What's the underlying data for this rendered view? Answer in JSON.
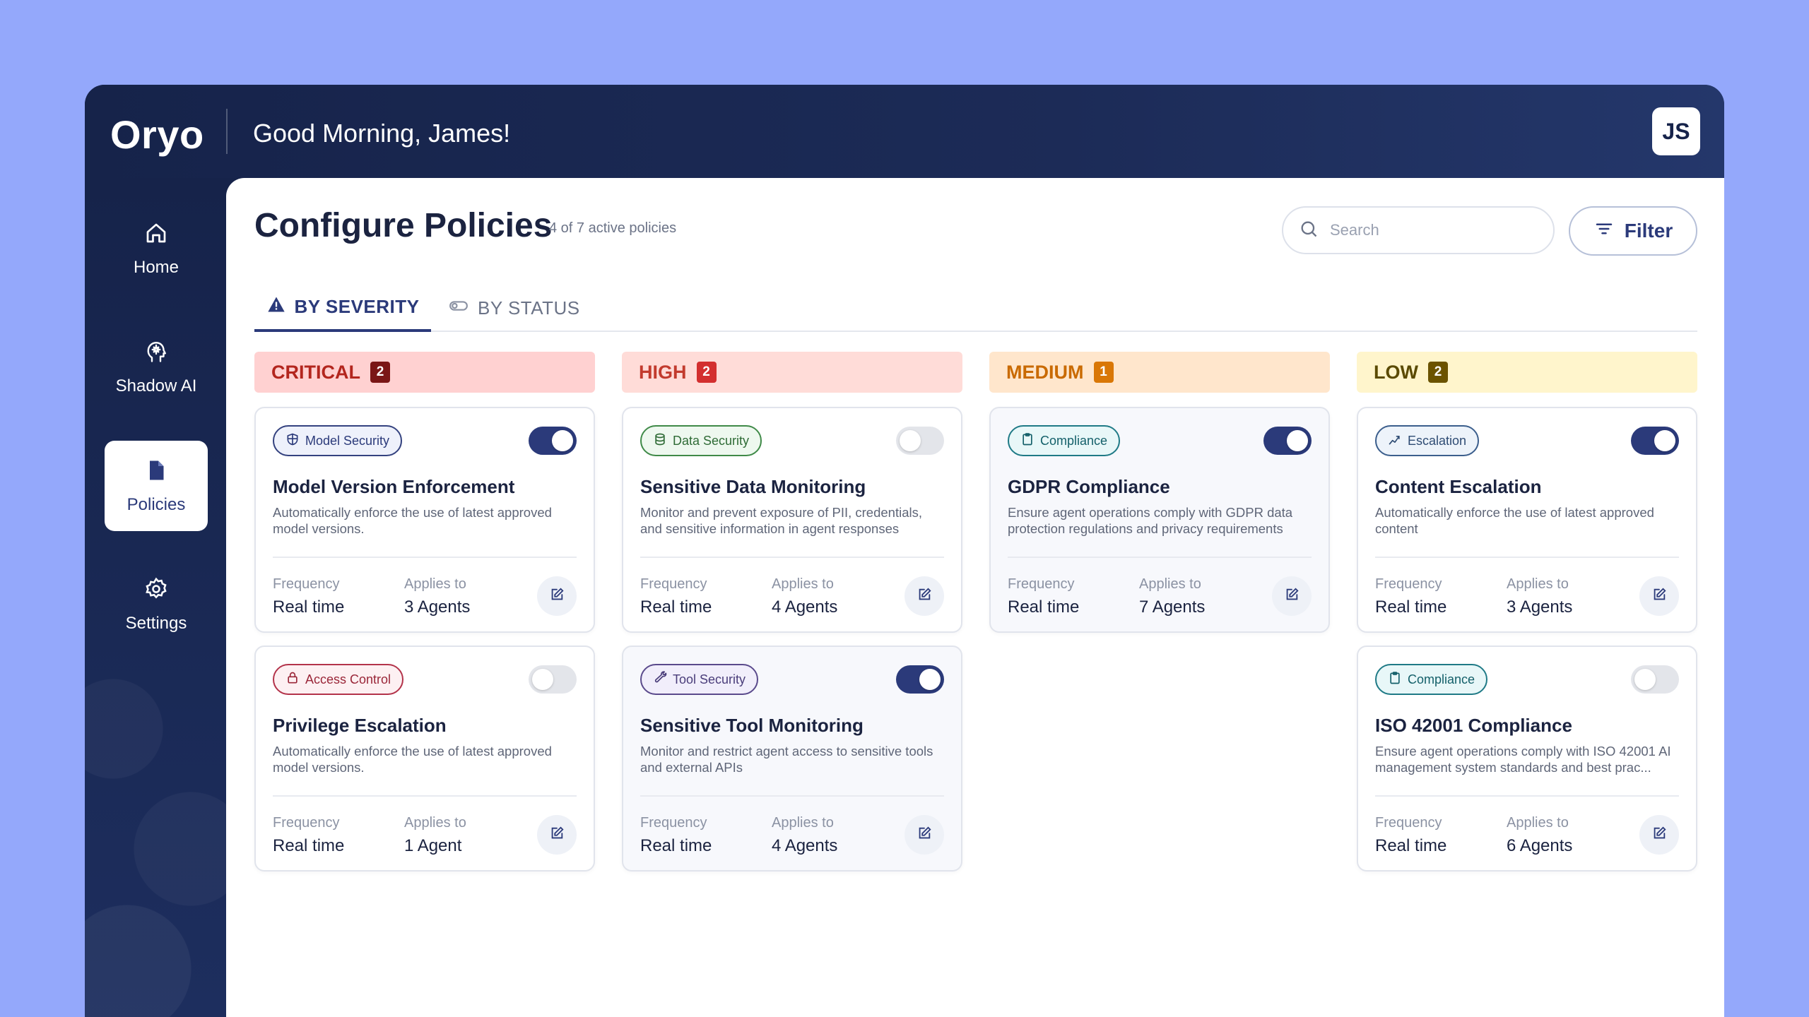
{
  "app": {
    "logo": "Oryo",
    "greeting": "Good Morning, James!",
    "avatar_initials": "JS"
  },
  "sidebar": {
    "items": [
      {
        "label": "Home",
        "icon": "home-icon",
        "active": false
      },
      {
        "label": "Shadow AI",
        "icon": "brain-icon",
        "active": false
      },
      {
        "label": "Policies",
        "icon": "document-icon",
        "active": true
      },
      {
        "label": "Settings",
        "icon": "gear-icon",
        "active": false
      }
    ]
  },
  "header": {
    "title": "Configure Policies",
    "subtitle": "4 of 7 active policies",
    "search_placeholder": "Search",
    "filter_label": "Filter"
  },
  "tabs": [
    {
      "label": "BY SEVERITY",
      "icon": "warning-icon",
      "active": true
    },
    {
      "label": "BY STATUS",
      "icon": "toggle-icon",
      "active": false
    }
  ],
  "colors": {
    "accent": "#2b3a7a",
    "critical_bg": "#ffd1d1",
    "critical_text": "#b3261e",
    "critical_badge": "#7a1616",
    "high_bg": "#ffdcd8",
    "high_text": "#c23b2e",
    "high_badge": "#d32f2f",
    "medium_bg": "#ffe6cc",
    "medium_text": "#c96a00",
    "medium_badge": "#d97706",
    "low_bg": "#fff5cc",
    "low_text": "#5a4a00",
    "low_badge": "#6b5300"
  },
  "columns": [
    {
      "label": "CRITICAL",
      "count": "2",
      "cards": [
        {
          "tag": "Model Security",
          "tag_icon": "shield-icon",
          "enabled": true,
          "title": "Model Version Enforcement",
          "description": "Automatically enforce the use of latest approved model versions.",
          "frequency_label": "Frequency",
          "frequency": "Real time",
          "applies_label": "Applies to",
          "applies": "3 Agents"
        },
        {
          "tag": "Access Control",
          "tag_icon": "lock-icon",
          "enabled": false,
          "title": "Privilege Escalation",
          "description": "Automatically enforce the use of latest approved model versions.",
          "frequency_label": "Frequency",
          "frequency": "Real time",
          "applies_label": "Applies to",
          "applies": "1 Agent"
        }
      ]
    },
    {
      "label": "HIGH",
      "count": "2",
      "cards": [
        {
          "tag": "Data Security",
          "tag_icon": "database-icon",
          "enabled": false,
          "title": "Sensitive Data Monitoring",
          "description": "Monitor and prevent exposure of PII, credentials, and sensitive information in agent responses",
          "frequency_label": "Frequency",
          "frequency": "Real time",
          "applies_label": "Applies to",
          "applies": "4 Agents"
        },
        {
          "tag": "Tool Security",
          "tag_icon": "wrench-icon",
          "enabled": true,
          "title": "Sensitive Tool Monitoring",
          "description": "Monitor and restrict agent access to sensitive tools and external APIs",
          "frequency_label": "Frequency",
          "frequency": "Real time",
          "applies_label": "Applies to",
          "applies": "4 Agents"
        }
      ]
    },
    {
      "label": "MEDIUM",
      "count": "1",
      "cards": [
        {
          "tag": "Compliance",
          "tag_icon": "clipboard-icon",
          "enabled": true,
          "title": "GDPR Compliance",
          "description": "Ensure agent operations comply with GDPR data protection regulations and privacy requirements",
          "frequency_label": "Frequency",
          "frequency": "Real time",
          "applies_label": "Applies to",
          "applies": "7 Agents"
        }
      ]
    },
    {
      "label": "LOW",
      "count": "2",
      "cards": [
        {
          "tag": "Escalation",
          "tag_icon": "trend-icon",
          "enabled": true,
          "title": "Content Escalation",
          "description": "Automatically enforce the use of latest approved content",
          "frequency_label": "Frequency",
          "frequency": "Real time",
          "applies_label": "Applies to",
          "applies": "3 Agents"
        },
        {
          "tag": "Compliance",
          "tag_icon": "clipboard-icon",
          "enabled": false,
          "title": "ISO 42001 Compliance",
          "description": "Ensure agent operations comply with ISO 42001 AI management system standards and best prac...",
          "frequency_label": "Frequency",
          "frequency": "Real time",
          "applies_label": "Applies to",
          "applies": "6 Agents"
        }
      ]
    }
  ]
}
